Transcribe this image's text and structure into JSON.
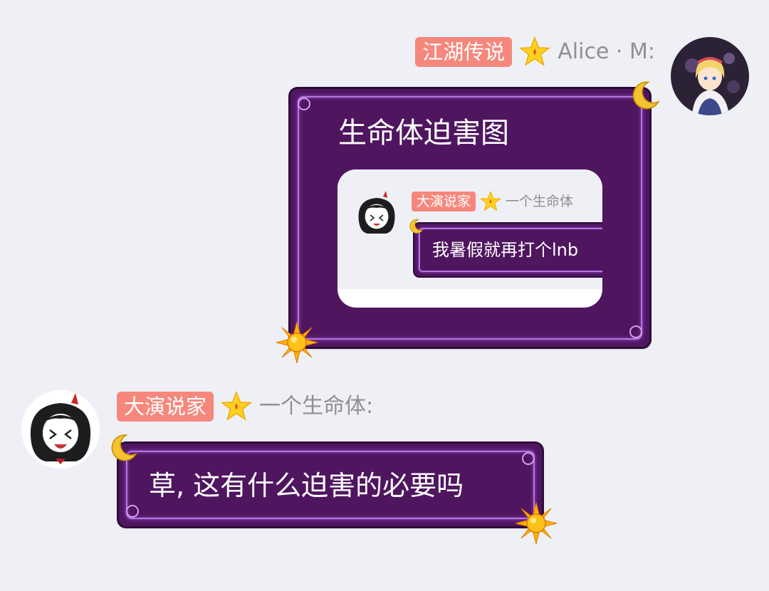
{
  "messages": [
    {
      "sender": {
        "badge": "江湖传说",
        "name": "Alice · M:",
        "avatar": "alice-avatar"
      },
      "title": "生命体迫害图",
      "quoted": {
        "badge": "大演说家",
        "name": "一个生命体",
        "text": "我暑假就再打个lnb"
      },
      "decorations": [
        "moon-icon",
        "sun-icon"
      ]
    },
    {
      "sender": {
        "badge": "大演说家",
        "name": "一个生命体:",
        "avatar": "chibi-avatar"
      },
      "text": "草, 这有什么迫害的必要吗",
      "decorations": [
        "moon-icon",
        "sun-icon"
      ]
    }
  ],
  "colors": {
    "background": "#eef0f6",
    "badge": "#f6877c",
    "bubble": "#4f165f",
    "bubble_glow": "#b873e4",
    "star": "#ffd21f",
    "moon": "#f4c430",
    "sun": "#ffb300",
    "nick_text": "#8f8f95"
  }
}
